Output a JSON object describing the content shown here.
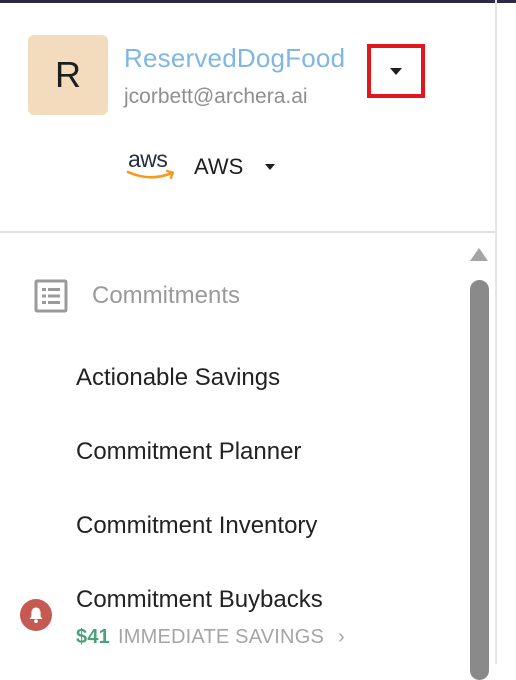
{
  "account": {
    "avatar_initial": "R",
    "name": "ReservedDogFood",
    "email": "jcorbett@archera.ai"
  },
  "cloud": {
    "logo_text": "aws",
    "label": "AWS"
  },
  "nav": {
    "section_label": "Commitments",
    "items": [
      {
        "label": "Actionable Savings"
      },
      {
        "label": "Commitment Planner"
      },
      {
        "label": "Commitment Inventory"
      },
      {
        "label": "Commitment Buybacks"
      }
    ],
    "buybacks_savings_amount": "$41",
    "buybacks_savings_label": "IMMEDIATE SAVINGS",
    "buybacks_chevron": "›"
  },
  "colors": {
    "account_name": "#7eb7e3",
    "highlight_box": "#e2171b",
    "savings_amount": "#4ea07a",
    "notification_badge": "#c65a52",
    "aws_smile": "#f59a1b"
  },
  "icons": {
    "account_dropdown": "caret-down-icon",
    "section": "list-icon",
    "notification": "bell-icon",
    "cloud_logo": "aws-logo"
  }
}
